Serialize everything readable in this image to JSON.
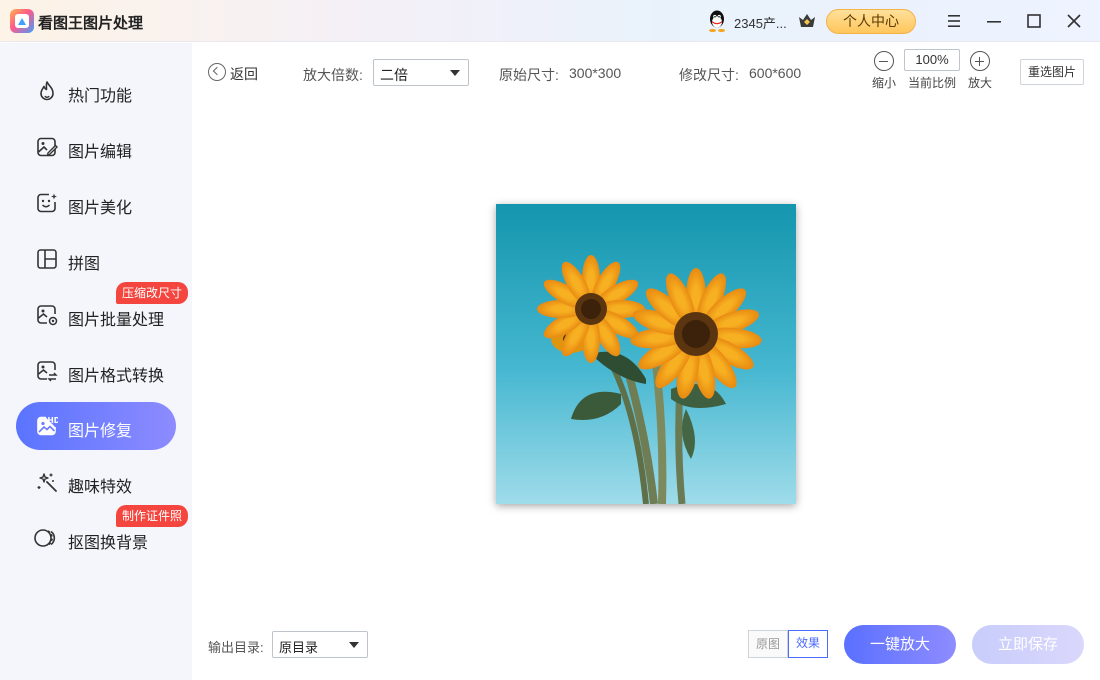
{
  "app": {
    "title": "看图王图片处理"
  },
  "user": {
    "name": "2345产...",
    "profile_label": "个人中心"
  },
  "window_controls": [
    "menu-icon",
    "minimize-icon",
    "maximize-icon",
    "close-icon"
  ],
  "sidebar": {
    "items": [
      {
        "label": "热门功能",
        "icon": "fire-icon"
      },
      {
        "label": "图片编辑",
        "icon": "image-edit-icon"
      },
      {
        "label": "图片美化",
        "icon": "image-beautify-icon"
      },
      {
        "label": "拼图",
        "icon": "collage-icon"
      },
      {
        "label": "图片批量处理",
        "icon": "batch-process-icon",
        "badge": "压缩改尺寸"
      },
      {
        "label": "图片格式转换",
        "icon": "format-convert-icon"
      },
      {
        "label": "图片修复",
        "icon": "hd-repair-icon",
        "active": true
      },
      {
        "label": "趣味特效",
        "icon": "magic-wand-icon"
      },
      {
        "label": "抠图换背景",
        "icon": "cutout-icon",
        "badge": "制作证件照"
      }
    ]
  },
  "toolbar": {
    "back_label": "返回",
    "scale_label": "放大倍数:",
    "scale_value": "二倍",
    "original_size_label": "原始尺寸:",
    "original_size_value": "300*300",
    "modified_size_label": "修改尺寸:",
    "modified_size_value": "600*600",
    "zoom_out_label": "缩小",
    "zoom_value": "100%",
    "zoom_current_label": "当前比例",
    "zoom_in_label": "放大",
    "reselect_label": "重选图片"
  },
  "bottom": {
    "output_label": "输出目录:",
    "output_value": "原目录",
    "original_toggle": "原图",
    "effect_toggle": "效果",
    "enlarge_button": "一键放大",
    "save_button": "立即保存"
  },
  "colors": {
    "accent": "#5a74ff",
    "badge": "#f4463f",
    "profile_button": "#ffc65c"
  }
}
